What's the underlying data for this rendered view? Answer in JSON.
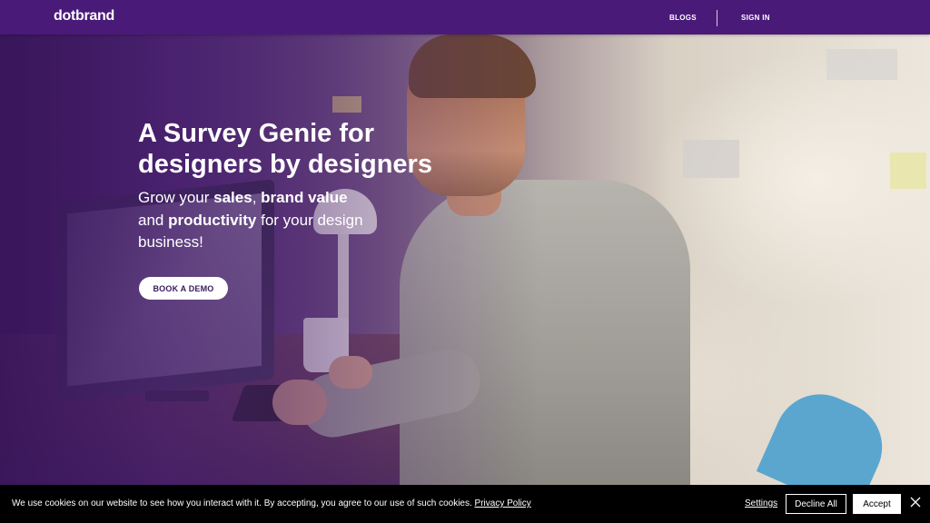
{
  "header": {
    "logo": "dotbrand",
    "nav": {
      "blogs": "BLOGS",
      "sign_in": "SIGN IN"
    }
  },
  "hero": {
    "headline_line1": "A Survey Genie for",
    "headline_line2": "designers by designers",
    "sub": {
      "part1": "Grow your ",
      "bold1": "sales",
      "part2": ", ",
      "bold2": "brand value",
      "part3": " and ",
      "bold3": "productivity",
      "part4": " for your design business!"
    },
    "cta": "BOOK A DEMO"
  },
  "cookie_banner": {
    "text": "We use cookies on our website to see how you interact with it. By accepting, you agree to our use of such cookies.",
    "privacy_link": "Privacy Policy",
    "settings": "Settings",
    "decline": "Decline All",
    "accept": "Accept"
  },
  "colors": {
    "header_bg": "#4a1a78",
    "hero_purple": "#3a1b5e",
    "cookie_bg": "#000000"
  }
}
